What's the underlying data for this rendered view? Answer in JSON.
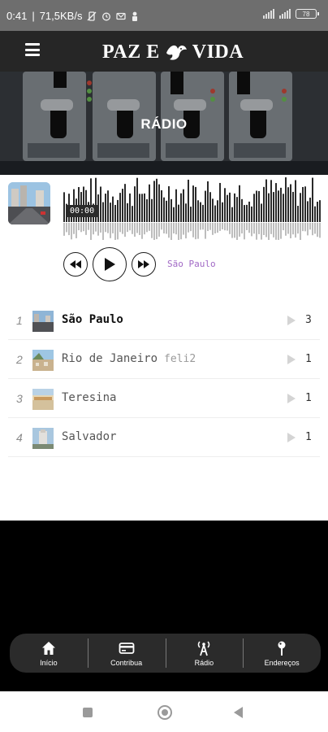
{
  "status_bar": {
    "time": "0:41",
    "net_speed": "71,5KB/s",
    "battery": "78",
    "icons": [
      "vibrate-off-icon",
      "alarm-icon",
      "sim-icon",
      "person-icon",
      "signal-icon",
      "wifi-icon",
      "battery-icon"
    ]
  },
  "header": {
    "logo_text_left": "PAZ E",
    "logo_text_right": "VIDA",
    "menu_icon": "hamburger-menu-icon",
    "logo_icon": "dove-icon"
  },
  "hero": {
    "title": "RÁDIO"
  },
  "player": {
    "time": "00:00",
    "now_playing": "São Paulo",
    "controls": [
      "rewind-icon",
      "play-icon",
      "fast-forward-icon"
    ]
  },
  "playlist": [
    {
      "num": "1",
      "title": "São Paulo",
      "artist": "",
      "count": "3",
      "active": true
    },
    {
      "num": "2",
      "title": "Rio de Janeiro",
      "artist": "feli2",
      "count": "1",
      "active": false
    },
    {
      "num": "3",
      "title": "Teresina",
      "artist": "",
      "count": "1",
      "active": false
    },
    {
      "num": "4",
      "title": "Salvador",
      "artist": "",
      "count": "1",
      "active": false
    }
  ],
  "bottom_nav": [
    {
      "label": "Início",
      "icon": "home-icon"
    },
    {
      "label": "Contribua",
      "icon": "credit-card-icon"
    },
    {
      "label": "Rádio",
      "icon": "radio-tower-icon"
    },
    {
      "label": "Endereços",
      "icon": "map-pin-icon"
    }
  ],
  "colors": {
    "header_bg": "#262626",
    "accent_purple": "#a169c5",
    "nav_bg": "#2b2b2b"
  }
}
